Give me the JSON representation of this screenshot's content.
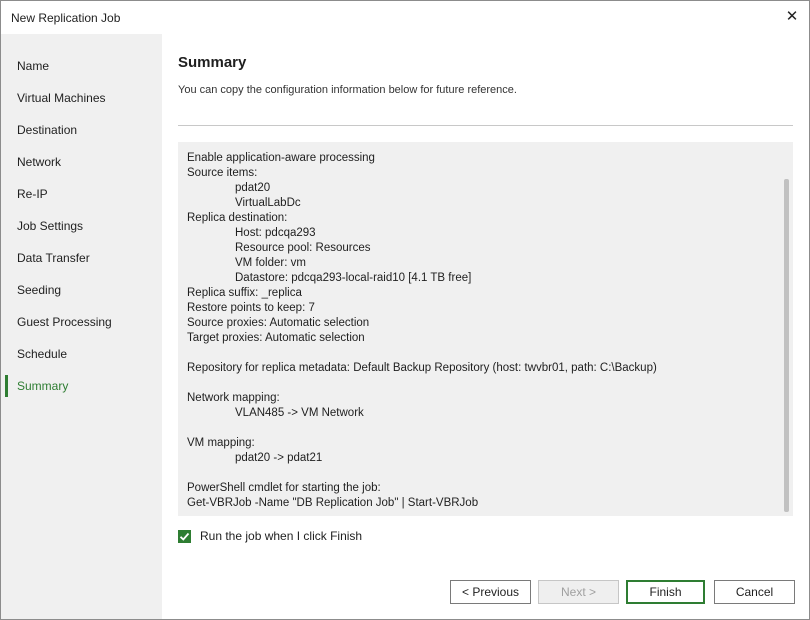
{
  "window": {
    "title": "New Replication Job",
    "close_icon": "close-icon"
  },
  "sidebar": {
    "steps": [
      {
        "label": "Name"
      },
      {
        "label": "Virtual Machines"
      },
      {
        "label": "Destination"
      },
      {
        "label": "Network"
      },
      {
        "label": "Re-IP"
      },
      {
        "label": "Job Settings"
      },
      {
        "label": "Data Transfer"
      },
      {
        "label": "Seeding"
      },
      {
        "label": "Guest Processing"
      },
      {
        "label": "Schedule"
      },
      {
        "label": "Summary",
        "active": true
      }
    ]
  },
  "main": {
    "heading": "Summary",
    "subheading": "You can copy the configuration information below for future reference.",
    "summary_lines": [
      "Enable application-aware processing",
      "Source items:",
      "pdat20",
      "VirtualLabDc",
      "Replica destination:",
      "Host: pdcqa293",
      "Resource pool: Resources",
      "VM folder: vm",
      "Datastore: pdcqa293-local-raid10 [4.1 TB free]",
      "Replica suffix: _replica",
      "Restore points to keep: 7",
      "Source proxies: Automatic selection",
      "Target proxies: Automatic selection",
      "",
      "Repository for replica metadata: Default Backup Repository (host: twvbr01, path: C:\\Backup)",
      "",
      "Network mapping:",
      "VLAN485 -> VM Network",
      "",
      "VM mapping:",
      "pdat20 -> pdat21",
      "",
      "PowerShell cmdlet for starting the job:",
      "Get-VBRJob -Name \"DB Replication Job\" | Start-VBRJob"
    ],
    "run_job_checkbox": {
      "label": "Run the job when I click Finish",
      "checked": true
    }
  },
  "buttons": {
    "previous": "< Previous",
    "next": "Next >",
    "finish": "Finish",
    "cancel": "Cancel"
  },
  "colors": {
    "accent": "#2e7d32",
    "sidebar_bg": "#f0f0f0"
  }
}
